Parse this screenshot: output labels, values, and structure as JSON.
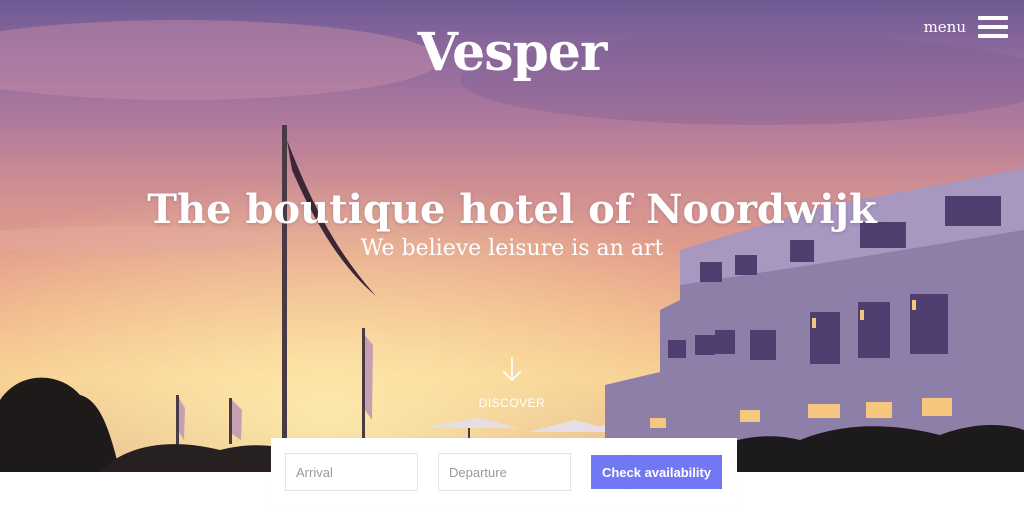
{
  "header": {
    "logo": "Vesper",
    "menu_label": "menu",
    "menu_icon": "hamburger-icon"
  },
  "hero": {
    "headline": "The boutique hotel of Noordwijk",
    "subheadline": "We believe leisure is an art",
    "discover_label": "DISCOVER",
    "discover_icon": "arrow-down-icon"
  },
  "booking": {
    "arrival_placeholder": "Arrival",
    "departure_placeholder": "Departure",
    "calendar_icon": "calendar-icon",
    "submit_label": "Check availability",
    "accent_color": "#7277f3"
  }
}
